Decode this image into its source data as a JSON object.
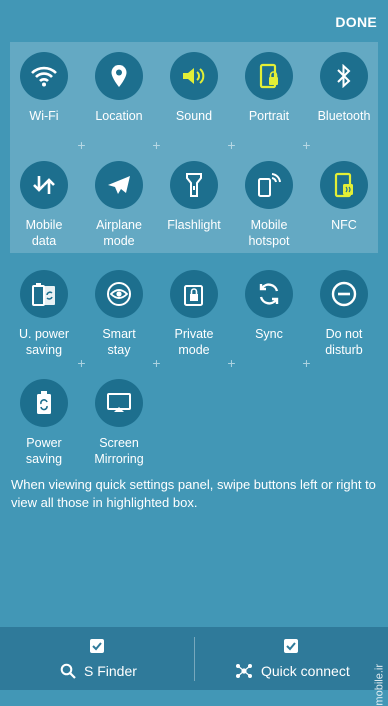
{
  "header": {
    "done_label": "DONE"
  },
  "tiles": [
    {
      "name": "wifi",
      "label": "Wi-Fi",
      "icon": "wifi-icon",
      "active": false
    },
    {
      "name": "location",
      "label": "Location",
      "icon": "location-pin-icon",
      "active": false
    },
    {
      "name": "sound",
      "label": "Sound",
      "icon": "speaker-icon",
      "active": true
    },
    {
      "name": "portrait",
      "label": "Portrait",
      "icon": "rotation-lock-icon",
      "active": true
    },
    {
      "name": "bluetooth",
      "label": "Bluetooth",
      "icon": "bluetooth-icon",
      "active": false
    },
    {
      "name": "mobile-data",
      "label": "Mobile\ndata",
      "icon": "data-arrows-icon",
      "active": false
    },
    {
      "name": "airplane-mode",
      "label": "Airplane\nmode",
      "icon": "airplane-icon",
      "active": false
    },
    {
      "name": "flashlight",
      "label": "Flashlight",
      "icon": "flashlight-icon",
      "active": false
    },
    {
      "name": "mobile-hotspot",
      "label": "Mobile\nhotspot",
      "icon": "hotspot-icon",
      "active": false
    },
    {
      "name": "nfc",
      "label": "NFC",
      "icon": "nfc-icon",
      "active": true
    },
    {
      "name": "power-saving",
      "label": "U. power\nsaving",
      "icon": "battery-recycle-icon",
      "active": false
    },
    {
      "name": "smart-stay",
      "label": "Smart\nstay",
      "icon": "eye-icon",
      "active": false
    },
    {
      "name": "private-mode",
      "label": "Private\nmode",
      "icon": "private-lock-icon",
      "active": false
    },
    {
      "name": "sync",
      "label": "Sync",
      "icon": "sync-icon",
      "active": false
    },
    {
      "name": "do-not-disturb",
      "label": "Do not\ndisturb",
      "icon": "minus-circle-icon",
      "active": false
    },
    {
      "name": "power-saving-2",
      "label": "Power\nsaving",
      "icon": "battery-icon",
      "active": false
    },
    {
      "name": "screen-mirroring",
      "label": "Screen\nMirroring",
      "icon": "cast-icon",
      "active": false
    }
  ],
  "instructions": "When viewing quick settings panel, swipe buttons left or right to view all those in highlighted box.",
  "bottom": {
    "s_finder_label": "S Finder",
    "quick_connect_label": "Quick connect",
    "s_finder_checked": true,
    "quick_connect_checked": true
  },
  "watermark": "mobile.ir",
  "colors": {
    "background": "#4297b6",
    "tile_circle": "#1d6f8e",
    "active_icon": "#e3ef36",
    "bottom_bar": "#2f7a9a"
  }
}
